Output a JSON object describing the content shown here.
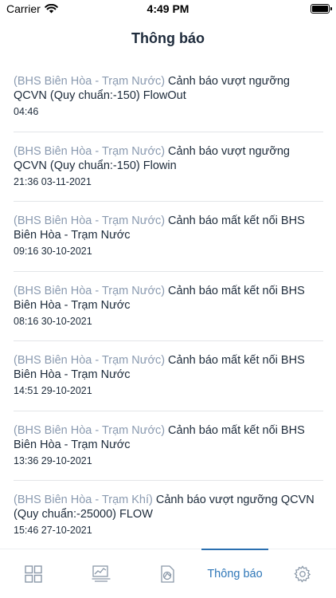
{
  "status_bar": {
    "carrier": "Carrier",
    "time": "4:49 PM"
  },
  "header": {
    "title": "Thông báo"
  },
  "notifications": [
    {
      "source": "(BHS Biên Hòa - Trạm Nước)",
      "message": " Cảnh báo vượt ngưỡng QCVN (Quy chuẩn:-150) FlowOut",
      "time": "04:46"
    },
    {
      "source": "(BHS Biên Hòa - Trạm Nước)",
      "message": " Cảnh báo vượt ngưỡng QCVN (Quy chuẩn:-150) Flowin",
      "time": "21:36 03-11-2021"
    },
    {
      "source": "(BHS Biên Hòa - Trạm Nước)",
      "message": " Cảnh báo mất kết nối BHS Biên Hòa - Trạm Nước",
      "time": "09:16 30-10-2021"
    },
    {
      "source": "(BHS Biên Hòa - Trạm Nước)",
      "message": " Cảnh báo mất kết nối BHS Biên Hòa - Trạm Nước",
      "time": "08:16 30-10-2021"
    },
    {
      "source": "(BHS Biên Hòa - Trạm Nước)",
      "message": " Cảnh báo mất kết nối BHS Biên Hòa - Trạm Nước",
      "time": "14:51 29-10-2021"
    },
    {
      "source": "(BHS Biên Hòa - Trạm Nước)",
      "message": " Cảnh báo mất kết nối BHS Biên Hòa - Trạm Nước",
      "time": "13:36 29-10-2021"
    },
    {
      "source": "(BHS Biên Hòa - Trạm Khí)",
      "message": " Cảnh báo vượt ngưỡng QCVN (Quy chuẩn:-25000) FLOW",
      "time": "15:46 27-10-2021"
    }
  ],
  "tabbar": {
    "active_label": "Thông báo",
    "icons": [
      "dashboard-grid-icon",
      "monitor-chart-icon",
      "report-document-icon",
      "settings-gear-icon"
    ]
  },
  "colors": {
    "accent": "#2f77b8",
    "source_text": "#8a9ab0",
    "body_text": "#1c2a3a",
    "divider": "#e3e5e8"
  }
}
